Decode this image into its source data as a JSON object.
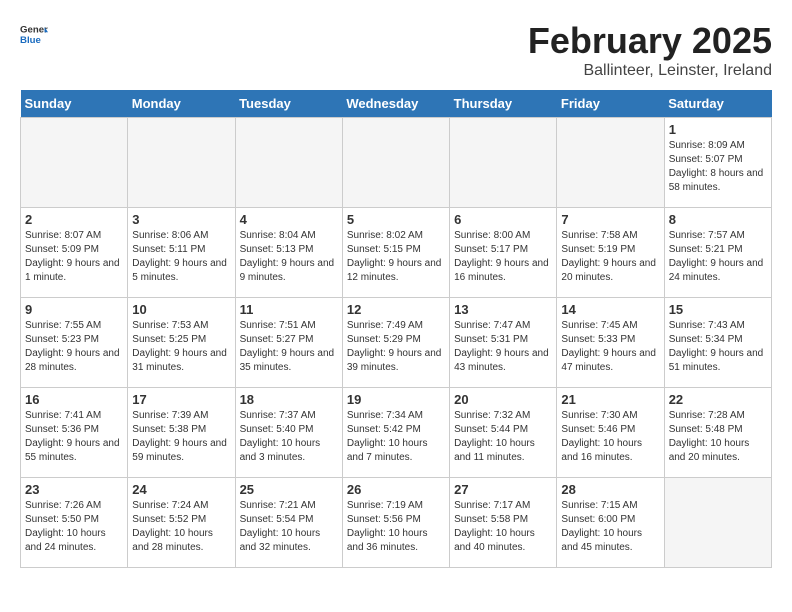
{
  "header": {
    "logo_general": "General",
    "logo_blue": "Blue",
    "month_year": "February 2025",
    "location": "Ballinteer, Leinster, Ireland"
  },
  "days_of_week": [
    "Sunday",
    "Monday",
    "Tuesday",
    "Wednesday",
    "Thursday",
    "Friday",
    "Saturday"
  ],
  "weeks": [
    [
      {
        "day": "",
        "info": ""
      },
      {
        "day": "",
        "info": ""
      },
      {
        "day": "",
        "info": ""
      },
      {
        "day": "",
        "info": ""
      },
      {
        "day": "",
        "info": ""
      },
      {
        "day": "",
        "info": ""
      },
      {
        "day": "1",
        "info": "Sunrise: 8:09 AM\nSunset: 5:07 PM\nDaylight: 8 hours and 58 minutes."
      }
    ],
    [
      {
        "day": "2",
        "info": "Sunrise: 8:07 AM\nSunset: 5:09 PM\nDaylight: 9 hours and 1 minute."
      },
      {
        "day": "3",
        "info": "Sunrise: 8:06 AM\nSunset: 5:11 PM\nDaylight: 9 hours and 5 minutes."
      },
      {
        "day": "4",
        "info": "Sunrise: 8:04 AM\nSunset: 5:13 PM\nDaylight: 9 hours and 9 minutes."
      },
      {
        "day": "5",
        "info": "Sunrise: 8:02 AM\nSunset: 5:15 PM\nDaylight: 9 hours and 12 minutes."
      },
      {
        "day": "6",
        "info": "Sunrise: 8:00 AM\nSunset: 5:17 PM\nDaylight: 9 hours and 16 minutes."
      },
      {
        "day": "7",
        "info": "Sunrise: 7:58 AM\nSunset: 5:19 PM\nDaylight: 9 hours and 20 minutes."
      },
      {
        "day": "8",
        "info": "Sunrise: 7:57 AM\nSunset: 5:21 PM\nDaylight: 9 hours and 24 minutes."
      }
    ],
    [
      {
        "day": "9",
        "info": "Sunrise: 7:55 AM\nSunset: 5:23 PM\nDaylight: 9 hours and 28 minutes."
      },
      {
        "day": "10",
        "info": "Sunrise: 7:53 AM\nSunset: 5:25 PM\nDaylight: 9 hours and 31 minutes."
      },
      {
        "day": "11",
        "info": "Sunrise: 7:51 AM\nSunset: 5:27 PM\nDaylight: 9 hours and 35 minutes."
      },
      {
        "day": "12",
        "info": "Sunrise: 7:49 AM\nSunset: 5:29 PM\nDaylight: 9 hours and 39 minutes."
      },
      {
        "day": "13",
        "info": "Sunrise: 7:47 AM\nSunset: 5:31 PM\nDaylight: 9 hours and 43 minutes."
      },
      {
        "day": "14",
        "info": "Sunrise: 7:45 AM\nSunset: 5:33 PM\nDaylight: 9 hours and 47 minutes."
      },
      {
        "day": "15",
        "info": "Sunrise: 7:43 AM\nSunset: 5:34 PM\nDaylight: 9 hours and 51 minutes."
      }
    ],
    [
      {
        "day": "16",
        "info": "Sunrise: 7:41 AM\nSunset: 5:36 PM\nDaylight: 9 hours and 55 minutes."
      },
      {
        "day": "17",
        "info": "Sunrise: 7:39 AM\nSunset: 5:38 PM\nDaylight: 9 hours and 59 minutes."
      },
      {
        "day": "18",
        "info": "Sunrise: 7:37 AM\nSunset: 5:40 PM\nDaylight: 10 hours and 3 minutes."
      },
      {
        "day": "19",
        "info": "Sunrise: 7:34 AM\nSunset: 5:42 PM\nDaylight: 10 hours and 7 minutes."
      },
      {
        "day": "20",
        "info": "Sunrise: 7:32 AM\nSunset: 5:44 PM\nDaylight: 10 hours and 11 minutes."
      },
      {
        "day": "21",
        "info": "Sunrise: 7:30 AM\nSunset: 5:46 PM\nDaylight: 10 hours and 16 minutes."
      },
      {
        "day": "22",
        "info": "Sunrise: 7:28 AM\nSunset: 5:48 PM\nDaylight: 10 hours and 20 minutes."
      }
    ],
    [
      {
        "day": "23",
        "info": "Sunrise: 7:26 AM\nSunset: 5:50 PM\nDaylight: 10 hours and 24 minutes."
      },
      {
        "day": "24",
        "info": "Sunrise: 7:24 AM\nSunset: 5:52 PM\nDaylight: 10 hours and 28 minutes."
      },
      {
        "day": "25",
        "info": "Sunrise: 7:21 AM\nSunset: 5:54 PM\nDaylight: 10 hours and 32 minutes."
      },
      {
        "day": "26",
        "info": "Sunrise: 7:19 AM\nSunset: 5:56 PM\nDaylight: 10 hours and 36 minutes."
      },
      {
        "day": "27",
        "info": "Sunrise: 7:17 AM\nSunset: 5:58 PM\nDaylight: 10 hours and 40 minutes."
      },
      {
        "day": "28",
        "info": "Sunrise: 7:15 AM\nSunset: 6:00 PM\nDaylight: 10 hours and 45 minutes."
      },
      {
        "day": "",
        "info": ""
      }
    ]
  ]
}
